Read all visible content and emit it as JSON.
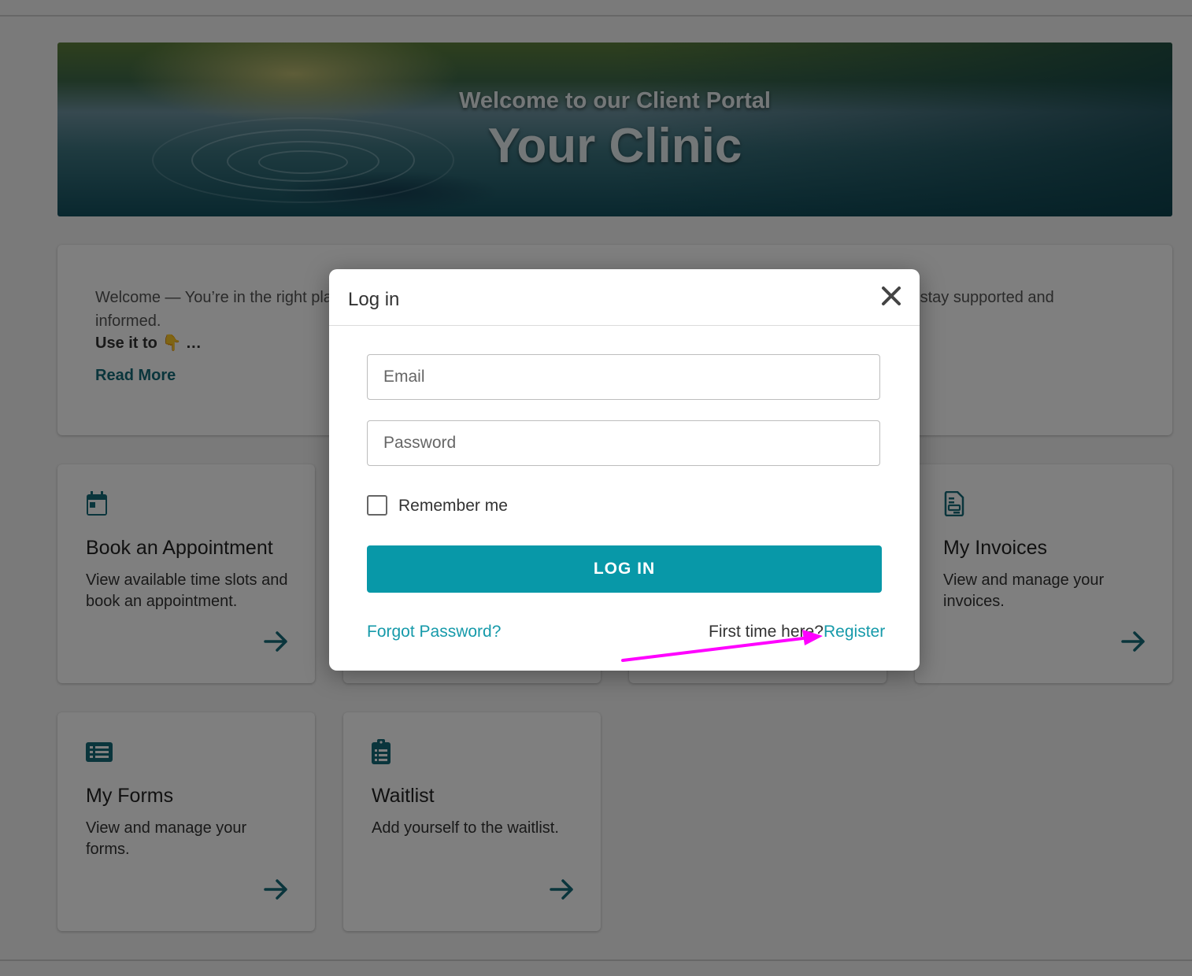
{
  "hero": {
    "subtitle": "Welcome to our Client Portal",
    "title": "Your Clinic"
  },
  "intro": {
    "text": "Welcome — You’re in the right place to feel supported, informed and connected — always. This client portal helps you stay supported and informed.",
    "bold": "Use it to 👇 …",
    "read_more": "Read More"
  },
  "tiles": [
    {
      "title": "Book an Appointment",
      "desc": "View available time slots and book an appointment.",
      "icon": "calendar-icon"
    },
    {
      "title": "My Invoices",
      "desc": "View and manage your invoices.",
      "icon": "invoice-icon"
    },
    {
      "title": "My Forms",
      "desc": "View and manage your forms.",
      "icon": "list-icon"
    },
    {
      "title": "Waitlist",
      "desc": "Add yourself to the waitlist.",
      "icon": "clipboard-icon"
    }
  ],
  "modal": {
    "title": "Log in",
    "email_placeholder": "Email",
    "password_placeholder": "Password",
    "remember_label": "Remember me",
    "login_button": "LOG IN",
    "forgot_link": "Forgot Password?",
    "first_time": "First time here?",
    "register_link": "Register"
  },
  "colors": {
    "accent": "#0898a8",
    "link": "#169aaa",
    "icon": "#146b78",
    "annotation": "#ff00ff"
  }
}
